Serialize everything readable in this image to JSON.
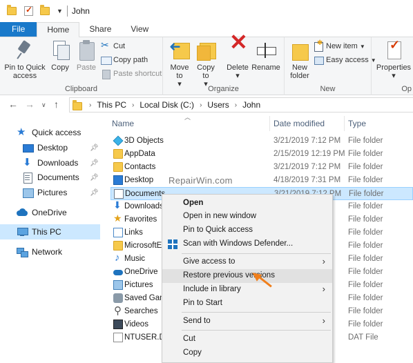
{
  "window": {
    "title": "John"
  },
  "ribbon_tabs": [
    "File",
    "Home",
    "Share",
    "View"
  ],
  "ribbon": {
    "clipboard": {
      "label": "Clipboard",
      "pin": "Pin to Quick access",
      "copy": "Copy",
      "paste": "Paste",
      "cut": "Cut",
      "copy_path": "Copy path",
      "paste_shortcut": "Paste shortcut"
    },
    "organize": {
      "label": "Organize",
      "move_to": "Move to",
      "copy_to": "Copy to",
      "delete": "Delete",
      "rename": "Rename"
    },
    "new": {
      "label": "New",
      "new_folder": "New folder",
      "new_item": "New item",
      "easy_access": "Easy access"
    },
    "open": {
      "label": "Op",
      "properties": "Properties"
    }
  },
  "address": {
    "crumbs": [
      "This PC",
      "Local Disk (C:)",
      "Users",
      "John"
    ]
  },
  "nav_pane": {
    "quick_access": "Quick access",
    "items": [
      "Desktop",
      "Downloads",
      "Documents",
      "Pictures"
    ],
    "onedrive": "OneDrive",
    "this_pc": "This PC",
    "network": "Network"
  },
  "columns": {
    "name": "Name",
    "date": "Date modified",
    "type": "Type"
  },
  "files": [
    {
      "name": "3D Objects",
      "date": "3/21/2019 7:12 PM",
      "type": "File folder"
    },
    {
      "name": "AppData",
      "date": "2/15/2019 12:19 PM",
      "type": "File folder"
    },
    {
      "name": "Contacts",
      "date": "3/21/2019 7:12 PM",
      "type": "File folder"
    },
    {
      "name": "Desktop",
      "date": "4/18/2019 7:31 PM",
      "type": "File folder"
    },
    {
      "name": "Documents",
      "date": "3/21/2019 7:12 PM",
      "type": "File folder"
    },
    {
      "name": "Downloads",
      "date": "",
      "type": "File folder"
    },
    {
      "name": "Favorites",
      "date": "",
      "type": "File folder"
    },
    {
      "name": "Links",
      "date": "",
      "type": "File folder"
    },
    {
      "name": "MicrosoftEd",
      "date": "",
      "type": "File folder"
    },
    {
      "name": "Music",
      "date": "",
      "type": "File folder"
    },
    {
      "name": "OneDrive",
      "date": "",
      "type": "File folder"
    },
    {
      "name": "Pictures",
      "date": "",
      "type": "File folder"
    },
    {
      "name": "Saved Gam",
      "date": "",
      "type": "File folder"
    },
    {
      "name": "Searches",
      "date": "",
      "type": "File folder"
    },
    {
      "name": "Videos",
      "date": "",
      "type": "File folder"
    },
    {
      "name": "NTUSER.DA",
      "date": "",
      "type": "DAT File"
    }
  ],
  "watermark": "RepairWin.com",
  "context_menu": {
    "open": "Open",
    "open_new_window": "Open in new window",
    "pin_quick_access": "Pin to Quick access",
    "scan_defender": "Scan with Windows Defender...",
    "give_access": "Give access to",
    "restore_versions": "Restore previous versions",
    "include_library": "Include in library",
    "pin_start": "Pin to Start",
    "send_to": "Send to",
    "cut": "Cut",
    "copy": "Copy"
  },
  "colors": {
    "accent": "#1979ca",
    "selection": "#cce8ff",
    "annotation_arrow": "#f07f1c"
  }
}
